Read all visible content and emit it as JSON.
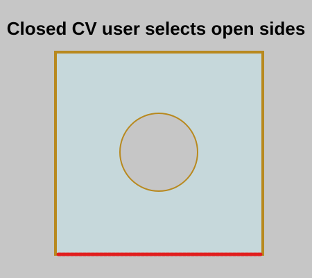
{
  "title": "Closed CV user selects open sides",
  "colors": {
    "background": "#c6c6c6",
    "cv_fill": "#c6d8db",
    "cv_border": "#b8891f",
    "hole_fill": "#c6c6c6",
    "open_side": "#e11e1e"
  },
  "diagram": {
    "control_volume": {
      "shape": "square",
      "fill_color_name": "light-blue-grey",
      "border_color_name": "dark-gold"
    },
    "hole": {
      "shape": "circle"
    },
    "open_sides": [
      "bottom"
    ],
    "open_side_style": "red-dotted"
  }
}
